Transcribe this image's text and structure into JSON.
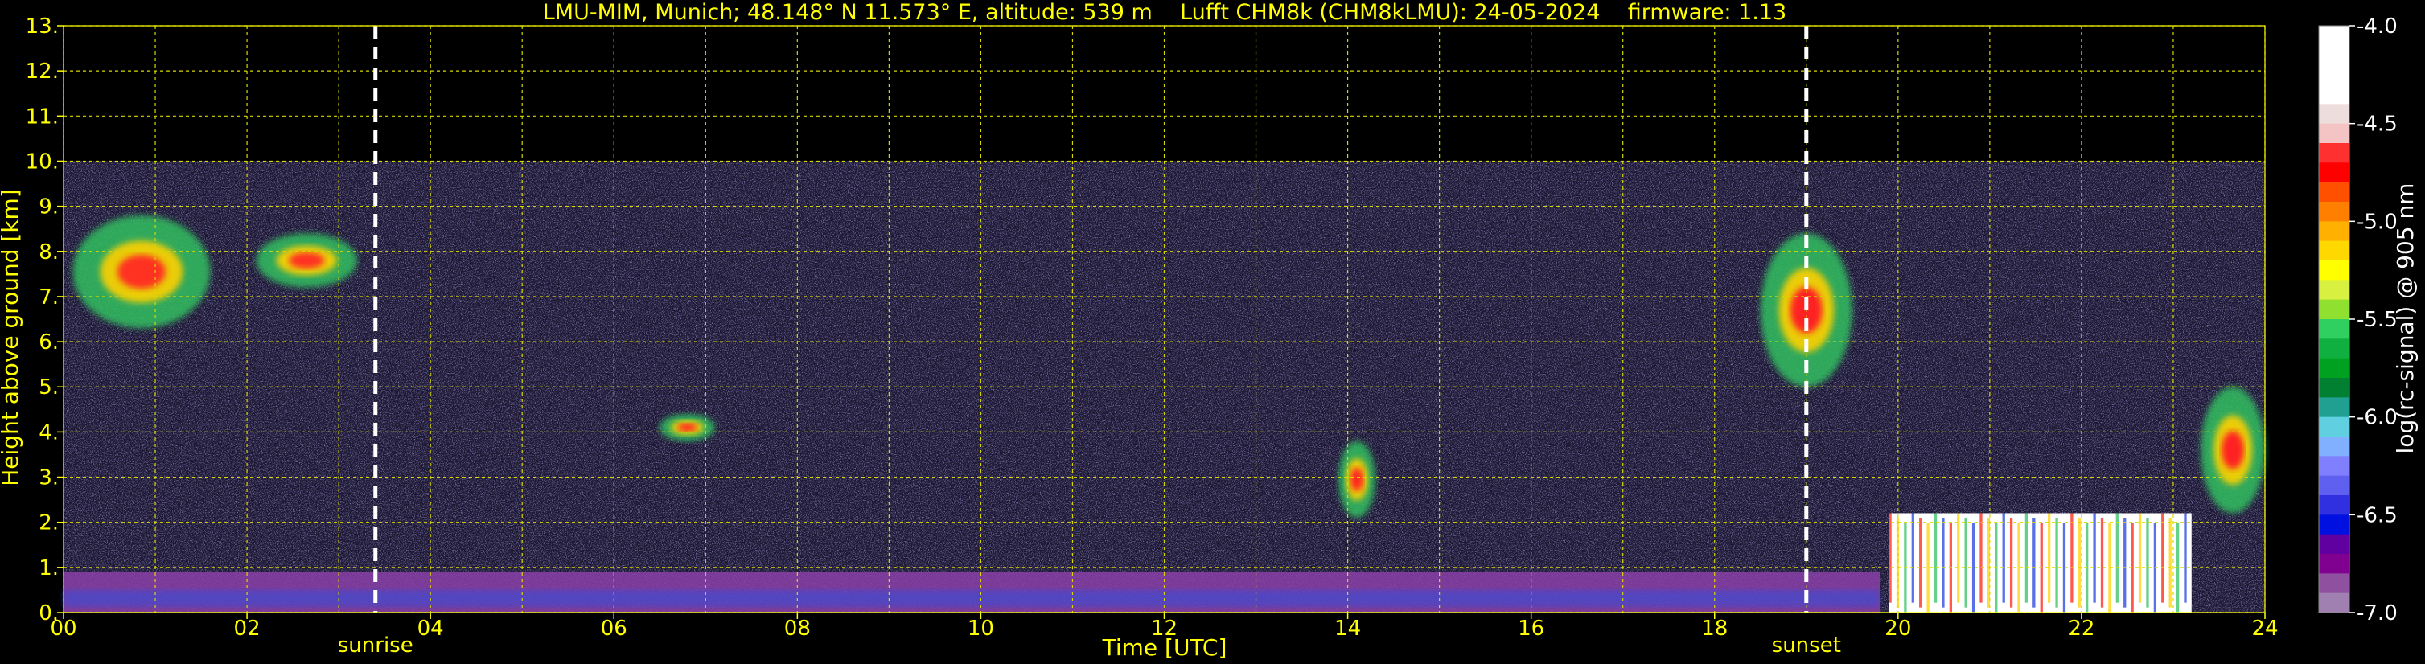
{
  "chart_data": {
    "type": "heatmap",
    "title": "LMU-MIM, Munich; 48.148° N 11.573° E, altitude: 539 m    Lufft CHM8k (CHM8kLMU): 24-05-2024    firmware: 1.13",
    "xlabel": "Time [UTC]",
    "ylabel": "Height above ground [km]",
    "xlim": [
      0,
      24
    ],
    "ylim": [
      0,
      13
    ],
    "x_ticks": [
      "00",
      "02",
      "04",
      "06",
      "08",
      "10",
      "12",
      "14",
      "16",
      "18",
      "20",
      "22",
      "24"
    ],
    "y_ticks": [
      "0.",
      "1.",
      "2.",
      "3.",
      "4.",
      "5.",
      "6.",
      "7.",
      "8.",
      "9.",
      "10.",
      "11.",
      "12.",
      "13."
    ],
    "data_ceiling_km": 10,
    "grid": true,
    "markers": [
      {
        "label": "sunrise",
        "time_h": 3.4
      },
      {
        "label": "sunset",
        "time_h": 19.0
      }
    ],
    "colorbar": {
      "label": "log(rc-signal) @ 905 nm",
      "range": [
        -7.0,
        -4.0
      ],
      "ticks": [
        "-4.0",
        "-4.5",
        "-5.0",
        "-5.5",
        "-6.0",
        "-6.5",
        "-7.0"
      ],
      "colors": [
        "#ffffff",
        "#ffffff",
        "#ffffff",
        "#ffffff",
        "#eedddd",
        "#f4c4c4",
        "#ff3030",
        "#ff0000",
        "#ff5000",
        "#ff8000",
        "#ffb000",
        "#ffd800",
        "#ffff00",
        "#d8f040",
        "#90e030",
        "#30d060",
        "#10b040",
        "#00a020",
        "#008030",
        "#20a090",
        "#60d0e0",
        "#80b0ff",
        "#8080ff",
        "#6060f0",
        "#3030e0",
        "#0010e0",
        "#6000a0",
        "#800090",
        "#9050a0",
        "#a080b0"
      ]
    },
    "features": [
      {
        "name": "boundary layer aerosol",
        "t0": 0,
        "t1": 19.8,
        "h0": 0,
        "h1": 0.9
      },
      {
        "name": "cirrus",
        "t0": 0.1,
        "t1": 1.6,
        "h0": 6.3,
        "h1": 8.8
      },
      {
        "name": "cirrus",
        "t0": 2.1,
        "t1": 3.2,
        "h0": 7.2,
        "h1": 8.4
      },
      {
        "name": "cloud",
        "t0": 6.5,
        "t1": 7.1,
        "h0": 3.8,
        "h1": 4.4
      },
      {
        "name": "cloud",
        "t0": 13.9,
        "t1": 14.3,
        "h0": 2.1,
        "h1": 3.8
      },
      {
        "name": "cloud",
        "t0": 18.5,
        "t1": 19.5,
        "h0": 5.0,
        "h1": 8.4
      },
      {
        "name": "low cloud",
        "t0": 19.9,
        "t1": 23.2,
        "h0": 0,
        "h1": 2.2
      },
      {
        "name": "cloud",
        "t0": 23.3,
        "t1": 24,
        "h0": 2.2,
        "h1": 5.0
      }
    ]
  }
}
